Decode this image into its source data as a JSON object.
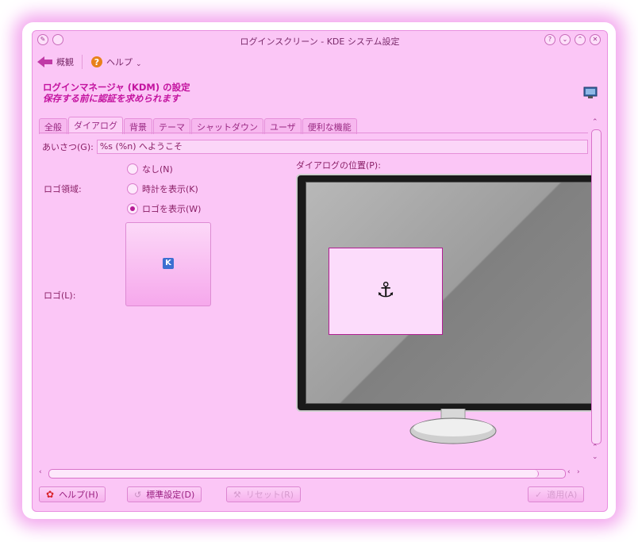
{
  "window": {
    "title": "ログインスクリーン - KDE システム設定",
    "left_buttons": [
      "app-icon",
      "sticky"
    ],
    "right_buttons": [
      "?",
      "⌄",
      "⌃",
      "✕"
    ]
  },
  "toolbar": {
    "back_label": "概観",
    "help_label": "ヘルプ"
  },
  "header": {
    "line1": "ログインマネージャ (KDM) の設定",
    "line2": "保存する前に認証を求められます"
  },
  "tabs": [
    {
      "label": "全般",
      "active": false
    },
    {
      "label": "ダイアログ",
      "active": true
    },
    {
      "label": "背景",
      "active": false
    },
    {
      "label": "テーマ",
      "active": false
    },
    {
      "label": "シャットダウン",
      "active": false
    },
    {
      "label": "ユーザ",
      "active": false
    },
    {
      "label": "便利な機能",
      "active": false
    }
  ],
  "greeting": {
    "label": "あいさつ(G):",
    "value": "%s (%n) へようこそ"
  },
  "logo_area": {
    "label": "ロゴ領域:",
    "options": [
      {
        "label": "なし(N)",
        "checked": false
      },
      {
        "label": "時計を表示(K)",
        "checked": false
      },
      {
        "label": "ロゴを表示(W)",
        "checked": true
      }
    ]
  },
  "logo": {
    "label": "ロゴ(L):",
    "icon": "kde-logo-icon"
  },
  "dialog_position": {
    "label": "ダイアログの位置(P):",
    "icon": "anchor-icon"
  },
  "buttons": {
    "help": "ヘルプ(H)",
    "defaults": "標準設定(D)",
    "reset": "リセット(R)",
    "apply": "適用(A)"
  },
  "colors": {
    "background": "#fbc6f6",
    "accent": "#c3139f",
    "text": "#8a1f66"
  }
}
